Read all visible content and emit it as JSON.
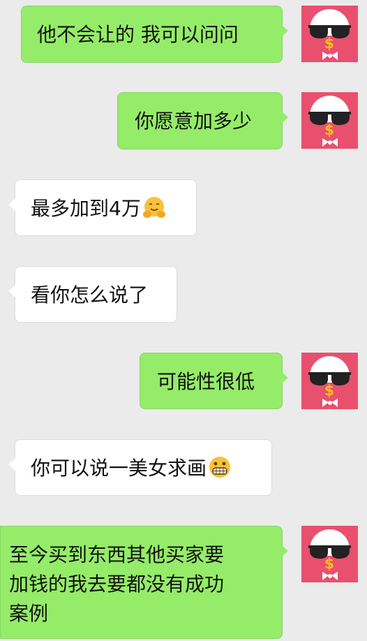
{
  "conversation": {
    "messages": [
      {
        "side": "right",
        "text": "他不会让的 我可以问问"
      },
      {
        "side": "right",
        "text": "你愿意加多少"
      },
      {
        "side": "left",
        "text": "最多加到4万",
        "emoji": "hugging-face-icon"
      },
      {
        "side": "left",
        "text": "看你怎么说了"
      },
      {
        "side": "right",
        "text": "可能性很低"
      },
      {
        "side": "left",
        "text": "你可以说一美女求画",
        "emoji": "grimacing-face-icon"
      },
      {
        "side": "right",
        "text": "至今买到东西其他买家要\n加钱的我去要都没有成功\n案例"
      }
    ]
  },
  "avatar": {
    "icon": "sunglasses-dollar-avatar-icon",
    "symbol": "$"
  },
  "colors": {
    "background": "#ebebeb",
    "sent_bubble": "#95ec69",
    "received_bubble": "#ffffff",
    "avatar_bg": "#e8506e"
  }
}
